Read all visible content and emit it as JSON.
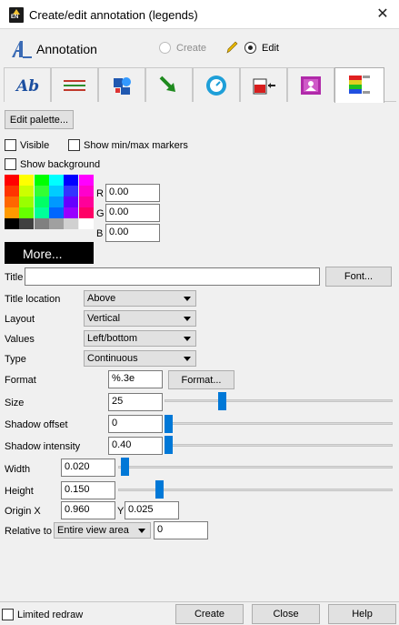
{
  "window": {
    "title": "Create/edit annotation (legends)"
  },
  "header": {
    "title": "Annotation",
    "mode_create": "Create",
    "mode_edit": "Edit",
    "selected_mode": "Edit"
  },
  "tabs": [
    {
      "name": "text-tab",
      "icon": "text-ab-icon"
    },
    {
      "name": "arrows-tab",
      "icon": "horizontal-arrows-icon"
    },
    {
      "name": "shapes-tab",
      "icon": "shapes-icon"
    },
    {
      "name": "line-tab",
      "icon": "green-arrow-icon"
    },
    {
      "name": "time-tab",
      "icon": "clock-icon"
    },
    {
      "name": "3d-tab",
      "icon": "red-box-icon"
    },
    {
      "name": "image-tab",
      "icon": "image-icon"
    },
    {
      "name": "legend-tab",
      "icon": "legend-icon",
      "active": true
    }
  ],
  "buttons": {
    "edit_palette": "Edit palette...",
    "more": "More...",
    "font": "Font...",
    "format": "Format..."
  },
  "checkboxes": {
    "visible": "Visible",
    "minmax": "Show min/max markers",
    "background": "Show background"
  },
  "color": {
    "r_label": "R",
    "g_label": "G",
    "b_label": "B",
    "r": "0.00",
    "g": "0.00",
    "b": "0.00"
  },
  "palette": [
    [
      "#ff0000",
      "#ffff00",
      "#00ff00",
      "#00ffff",
      "#0000ff",
      "#ff00ff"
    ],
    [
      "#ff3300",
      "#ccff00",
      "#33ff33",
      "#00ccff",
      "#3333ff",
      "#ff00cc"
    ],
    [
      "#ff6600",
      "#99ff00",
      "#00ff66",
      "#0099ff",
      "#6600ff",
      "#ff0099"
    ],
    [
      "#ff9900",
      "#66ff00",
      "#00ff99",
      "#0066ff",
      "#9900ff",
      "#ff0066"
    ],
    [
      "#000000",
      "#404040",
      "#808080",
      "#a0a0a0",
      "#d0d0d0",
      "#ffffff"
    ]
  ],
  "fields": {
    "title_label": "Title",
    "title_value": "",
    "title_location_label": "Title location",
    "title_location": "Above",
    "layout_label": "Layout",
    "layout": "Vertical",
    "values_label": "Values",
    "values": "Left/bottom",
    "type_label": "Type",
    "type": "Continuous",
    "format_label": "Format",
    "format": "%.3e",
    "size_label": "Size",
    "size": "25",
    "shadow_offset_label": "Shadow offset",
    "shadow_offset": "0",
    "shadow_intensity_label": "Shadow intensity",
    "shadow_intensity": "0.40",
    "width_label": "Width",
    "width": "0.020",
    "height_label": "Height",
    "height": "0.150",
    "origin_x_label": "Origin X",
    "origin_x": "0.960",
    "origin_y_label": "Y",
    "origin_y": "0.025",
    "relative_label": "Relative to",
    "relative": "Entire view area",
    "relative_value": "0"
  },
  "footer": {
    "limited_redraw": "Limited redraw",
    "create": "Create",
    "close": "Close",
    "help": "Help"
  }
}
